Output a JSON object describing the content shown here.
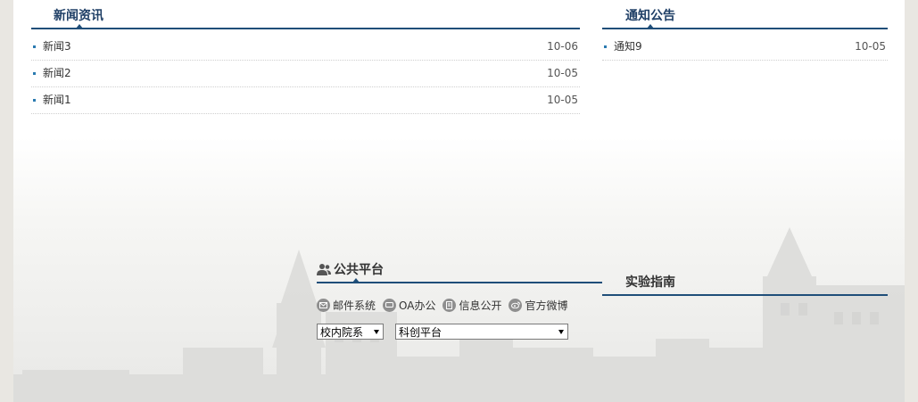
{
  "news": {
    "title": "新闻资讯",
    "items": [
      {
        "title": "新闻3",
        "date": "10-06"
      },
      {
        "title": "新闻2",
        "date": "10-05"
      },
      {
        "title": "新闻1",
        "date": "10-05"
      }
    ]
  },
  "notices": {
    "title": "通知公告",
    "items": [
      {
        "title": "通知9",
        "date": "10-05"
      }
    ]
  },
  "public_platform": {
    "title": "公共平台",
    "title_icon": "users-icon",
    "links": [
      {
        "label": "邮件系统",
        "icon": "mail-icon"
      },
      {
        "label": "OA办公",
        "icon": "chat-icon"
      },
      {
        "label": "信息公开",
        "icon": "document-icon"
      },
      {
        "label": "官方微博",
        "icon": "weibo-icon"
      }
    ],
    "selects": [
      {
        "selected": "校内院系"
      },
      {
        "selected": "科创平台"
      }
    ]
  },
  "lab_guide": {
    "title": "实验指南"
  },
  "colors": {
    "accent": "#1f4e79",
    "bullet": "#2a7ab0",
    "icon_gray": "#8f8f8f"
  }
}
